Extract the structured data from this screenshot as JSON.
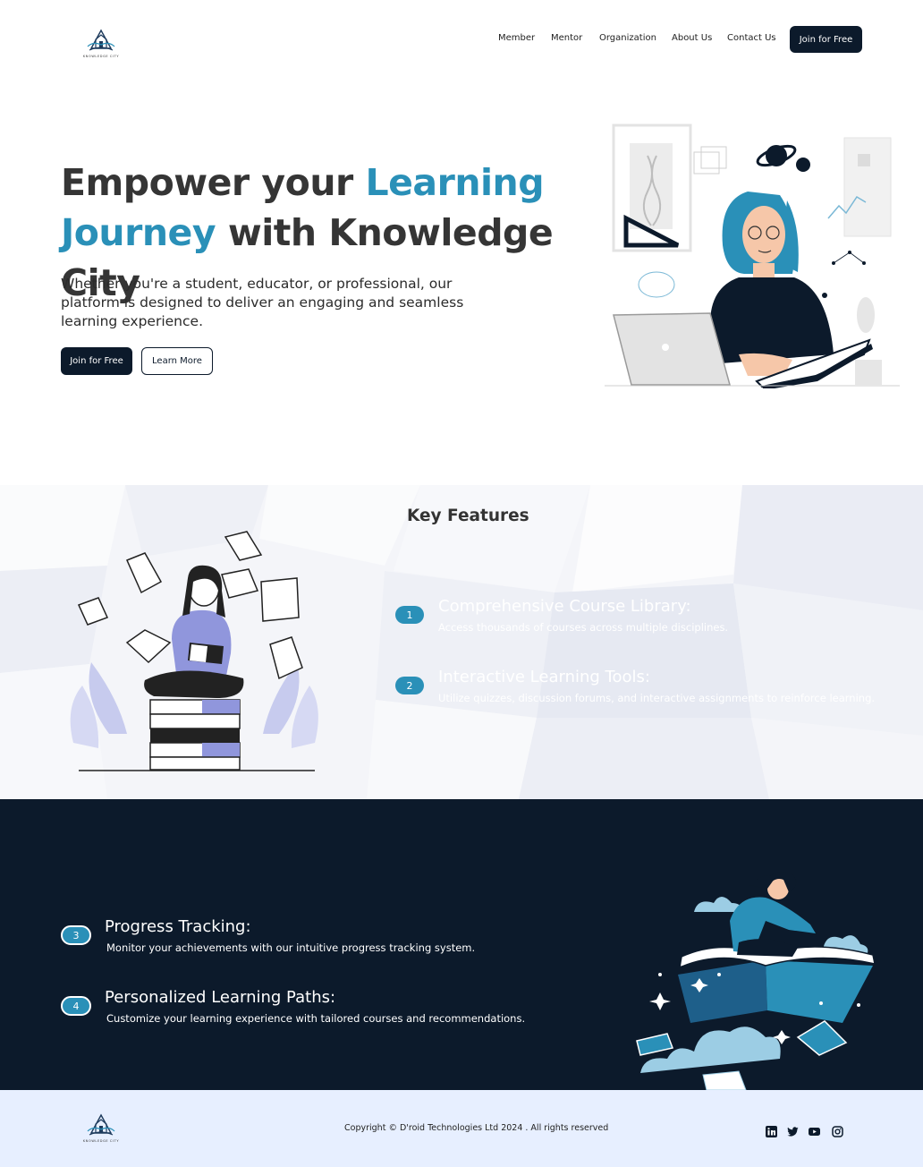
{
  "brand": {
    "logo_text": "KNOWLEDGE CITY"
  },
  "nav": {
    "items": [
      {
        "label": "Member"
      },
      {
        "label": "Mentor"
      },
      {
        "label": "Organization"
      },
      {
        "label": "About Us"
      },
      {
        "label": "Contact Us"
      }
    ],
    "cta_label": "Join for Free"
  },
  "hero": {
    "title_part1": "Empower your ",
    "title_accent1": "Learning",
    "title_accent2": "Journey",
    "title_part2": " with Knowledge City",
    "subtitle": "Whether you're a student, educator, or professional, our platform is designed to deliver an engaging and seamless learning experience.",
    "primary_button": "Join for Free",
    "secondary_button": "Learn More"
  },
  "features": {
    "heading": "Key Features",
    "items": [
      {
        "number": "1",
        "title": "Comprehensive Course Library:",
        "description": "Access thousands of courses across multiple disciplines."
      },
      {
        "number": "2",
        "title": "Interactive Learning Tools:",
        "description": "Utilize quizzes, discussion forums, and interactive assignments to reinforce learning."
      },
      {
        "number": "3",
        "title": "Progress Tracking:",
        "description": "Monitor your achievements with our intuitive progress tracking system."
      },
      {
        "number": "4",
        "title": "Personalized Learning Paths:",
        "description": "Customize your learning experience with tailored courses and recommendations."
      }
    ]
  },
  "footer": {
    "copyright": "Copyright © D'roid Technologies Ltd 2024 . All rights reserved",
    "social": [
      "linkedin-icon",
      "twitter-icon",
      "youtube-icon",
      "instagram-icon"
    ]
  },
  "colors": {
    "accent": "#2a90b8",
    "dark": "#0c1a2b",
    "footer_bg": "#e7efff",
    "features_bg": "#f4f5f9"
  }
}
